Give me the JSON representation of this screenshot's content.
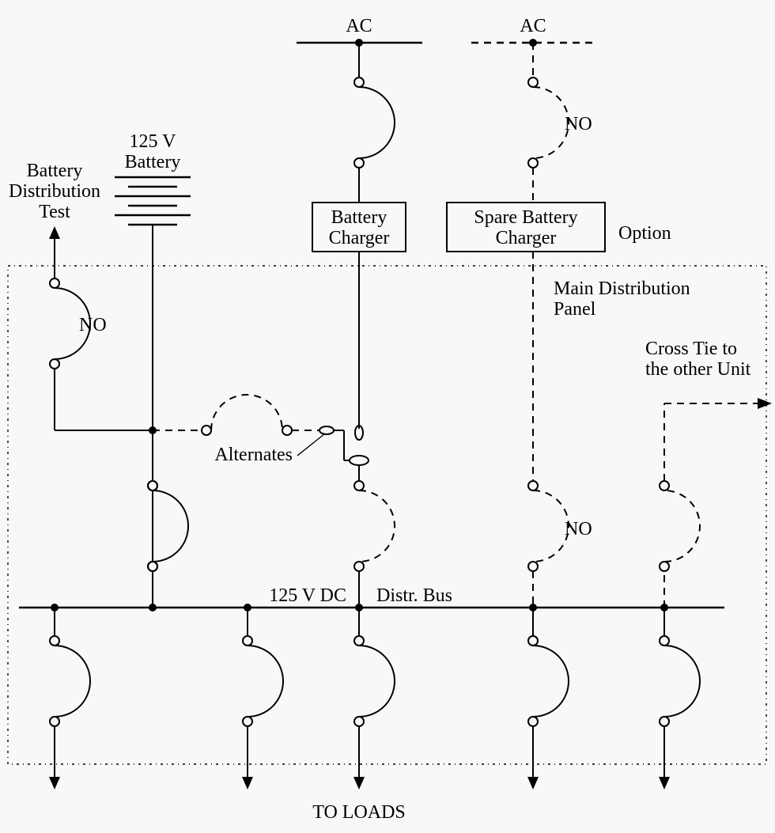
{
  "labels": {
    "ac_left": "AC",
    "ac_right": "AC",
    "battery_voltage": "125 V",
    "battery_name": "Battery",
    "test_l1": "Battery",
    "test_l2": "Distribution",
    "test_l3": "Test",
    "charger_l1": "Battery",
    "charger_l2": "Charger",
    "spare_l1": "Spare Battery",
    "spare_l2": "Charger",
    "option": "Option",
    "panel_l1": "Main Distribution",
    "panel_l2": "Panel",
    "crosstie_l1": "Cross Tie to",
    "crosstie_l2": "the other Unit",
    "alternates": "Alternates",
    "bus_left": "125 V DC",
    "bus_right": "Distr. Bus",
    "no1": "NO",
    "no2": "NO",
    "no3": "NO",
    "to_loads": "TO LOADS"
  }
}
